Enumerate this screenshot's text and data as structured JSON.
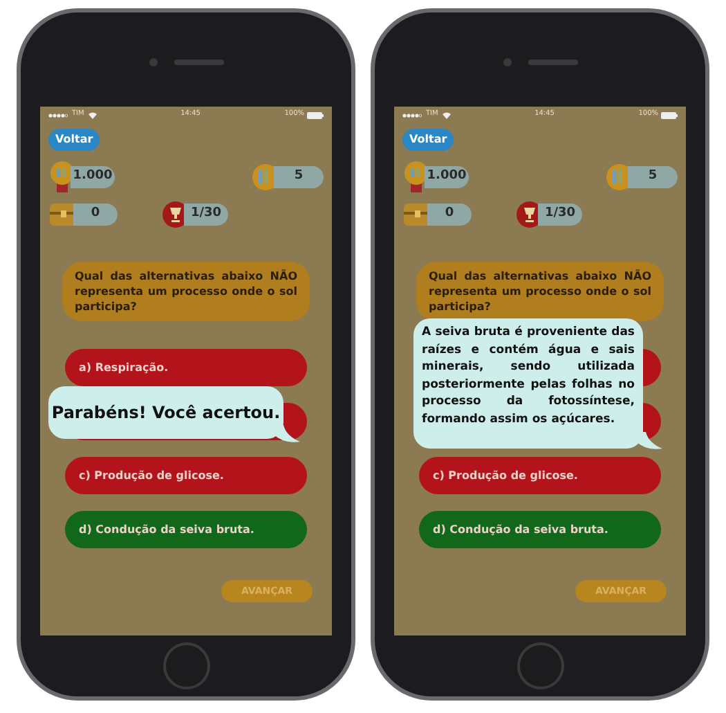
{
  "phones": [
    {
      "status_bar": {
        "carrier": "TIM",
        "time": "14:45",
        "battery": "100%"
      },
      "back_button": "Voltar",
      "stats": [
        {
          "kind": "medal",
          "value": "1.000"
        },
        {
          "kind": "books",
          "value": "5"
        },
        {
          "kind": "chest",
          "value": "0"
        },
        {
          "kind": "trophy",
          "value": "1/30"
        }
      ],
      "question": "Qual das alternativas abaixo NÃO representa um processo onde o sol participa?",
      "options": [
        {
          "label": "a) Respiração.",
          "color": "#b3141c"
        },
        {
          "color": "#b3141c"
        },
        {
          "label": "c) Produção de glicose.",
          "color": "#b3141c"
        },
        {
          "label": "d) Condução da seiva bruta.",
          "color": "#11671a"
        }
      ],
      "popup": {
        "kind": "short",
        "text": "Parabéns! Você acertou."
      },
      "next_button": "AVANÇAR"
    },
    {
      "status_bar": {
        "carrier": "TIM",
        "time": "14:45",
        "battery": "100%"
      },
      "back_button": "Voltar",
      "stats": [
        {
          "kind": "medal",
          "value": "1.000"
        },
        {
          "kind": "books",
          "value": "5"
        },
        {
          "kind": "chest",
          "value": "0"
        },
        {
          "kind": "trophy",
          "value": "1/30"
        }
      ],
      "question": "Qual das alternativas abaixo NÃO representa um processo onde o sol participa?",
      "options": [
        {
          "color": "#b3141c"
        },
        {
          "color": "#b3141c"
        },
        {
          "label": "c) Produção de glicose.",
          "color": "#b3141c"
        },
        {
          "label": "d) Condução da seiva bruta.",
          "color": "#11671a"
        }
      ],
      "popup": {
        "kind": "long",
        "text": "A seiva bruta é proveniente das raízes e contém água e sais minerais, sendo utilizada posteriormente pelas folhas no processo da fotossíntese, formando assim os açúcares."
      },
      "next_button": "AVANÇAR"
    }
  ]
}
